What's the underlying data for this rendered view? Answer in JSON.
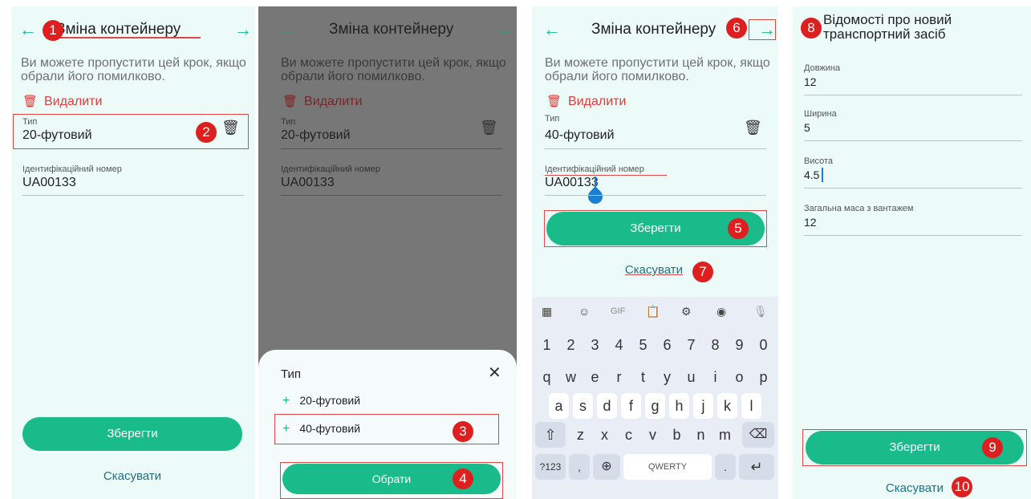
{
  "screen1": {
    "title": "Зміна контейнеру",
    "back_icon": "arrow-left-icon",
    "next_icon": "arrow-right-icon",
    "description": "Ви можете пропустити цей крок, якщо обрали його помилково.",
    "delete_label": "Видалити",
    "type_label": "Тип",
    "type_value": "20-футовий",
    "id_label": "Ідентифікаційний номер",
    "id_value": "UA00133",
    "save_label": "Зберегти",
    "cancel_label": "Скасувати"
  },
  "screen2": {
    "title": "Зміна контейнеру",
    "description": "Ви можете пропустити цей крок, якщо обрали його помилково.",
    "delete_label": "Видалити",
    "type_label": "Тип",
    "type_value": "20-футовий",
    "id_label": "Ідентифікаційний номер",
    "id_value": "UA00133",
    "sheet_title": "Тип",
    "options": [
      "20-футовий",
      "40-футовий"
    ],
    "choose_label": "Обрати"
  },
  "screen3": {
    "title": "Зміна контейнеру",
    "description": "Ви можете пропустити цей крок, якщо обрали його помилково.",
    "delete_label": "Видалити",
    "type_label": "Тип",
    "type_value": "40-футовий",
    "id_label": "Ідентифікаційний номер",
    "id_value": "UA00133",
    "save_label": "Зберегти",
    "cancel_label": "Скасувати",
    "keyboard": {
      "gif_label": "GIF",
      "numbers": [
        "1",
        "2",
        "3",
        "4",
        "5",
        "6",
        "7",
        "8",
        "9",
        "0"
      ],
      "row1": [
        "q",
        "w",
        "e",
        "r",
        "t",
        "y",
        "u",
        "i",
        "o",
        "p"
      ],
      "row2": [
        "a",
        "s",
        "d",
        "f",
        "g",
        "h",
        "j",
        "k",
        "l"
      ],
      "row3": [
        "z",
        "x",
        "c",
        "v",
        "b",
        "n",
        "m"
      ],
      "symbols_label": "?123",
      "comma": ",",
      "space_label": "QWERTY",
      "period": "."
    }
  },
  "screen4": {
    "title": "Відомості про новий транспортний засіб",
    "fields": [
      {
        "label": "Довжина",
        "value": "12"
      },
      {
        "label": "Ширина",
        "value": "5"
      },
      {
        "label": "Висота",
        "value": "4.5"
      },
      {
        "label": "Загальна маса з вантажем",
        "value": "12"
      }
    ],
    "save_label": "Зберегти",
    "cancel_label": "Скасувати"
  },
  "badges": [
    "1",
    "2",
    "3",
    "4",
    "5",
    "6",
    "7",
    "8",
    "9",
    "10"
  ],
  "colors": {
    "accent": "#19bb8a",
    "danger": "#e33a3a",
    "badge": "#dd1f1f",
    "link": "#1e6f86",
    "background": "#ecfbf8",
    "dim_overlay": "#777777"
  }
}
